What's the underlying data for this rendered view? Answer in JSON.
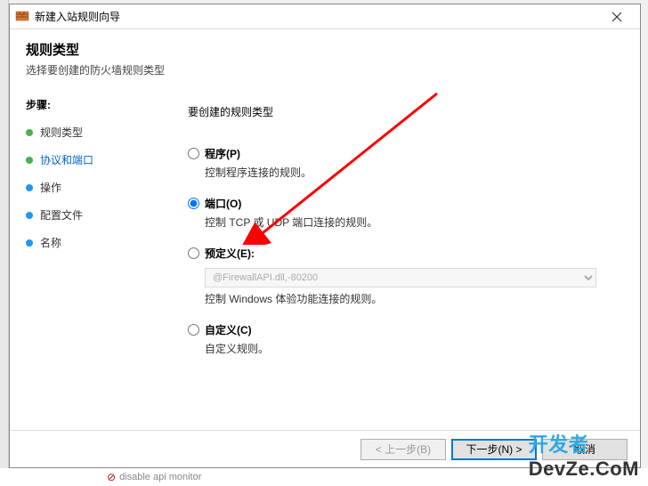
{
  "window": {
    "title": "新建入站规则向导"
  },
  "header": {
    "title": "规则类型",
    "subtitle": "选择要创建的防火墙规则类型"
  },
  "steps": {
    "header": "步骤:",
    "items": [
      {
        "label": "规则类型",
        "bullet": "green",
        "link": false
      },
      {
        "label": "协议和端口",
        "bullet": "green",
        "link": true
      },
      {
        "label": "操作",
        "bullet": "blue",
        "link": false
      },
      {
        "label": "配置文件",
        "bullet": "blue",
        "link": false
      },
      {
        "label": "名称",
        "bullet": "blue",
        "link": false
      }
    ]
  },
  "main": {
    "heading": "要创建的规则类型",
    "options": {
      "program": {
        "label": "程序(P)",
        "desc": "控制程序连接的规则。"
      },
      "port": {
        "label": "端口(O)",
        "desc": "控制 TCP 或 UDP 端口连接的规则。"
      },
      "predefined": {
        "label": "预定义(E):",
        "select": "@FirewallAPI.dll,-80200",
        "desc": "控制 Windows 体验功能连接的规则。"
      },
      "custom": {
        "label": "自定义(C)",
        "desc": "自定义规则。"
      }
    },
    "selected": "port"
  },
  "buttons": {
    "back": "< 上一步(B)",
    "next": "下一步(N) >",
    "cancel": "取消"
  },
  "background": {
    "disabled_item": "disable api monitor"
  },
  "watermark": {
    "part1": "开发者",
    "part2": "DevZe.CoM"
  }
}
